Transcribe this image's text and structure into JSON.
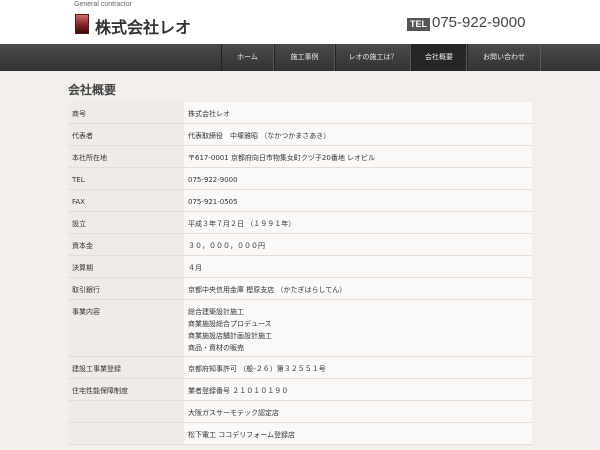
{
  "header": {
    "tagline": "General contractor",
    "company": "株式会社レオ",
    "tel_badge": "TEL",
    "tel_number": "075-922-9000"
  },
  "nav": {
    "items": [
      {
        "label": "ホーム"
      },
      {
        "label": "施工事例"
      },
      {
        "label": "レオの施工は？"
      },
      {
        "label": "会社概要",
        "active": true
      },
      {
        "label": "お問い合わせ"
      }
    ]
  },
  "section": {
    "title": "会社概要"
  },
  "table": {
    "rows": [
      {
        "label": "商号",
        "values": [
          "株式会社レオ"
        ]
      },
      {
        "label": "代表者",
        "values": [
          "代表取締役　中塚雅昭 （なかつかまさあき）"
        ]
      },
      {
        "label": "本社所在地",
        "values": [
          "〒617-0001 京都府向日市物集女町クヅ子20番地 レオビル"
        ]
      },
      {
        "label": "TEL",
        "values": [
          "075-922-9000"
        ]
      },
      {
        "label": "FAX",
        "values": [
          "075-921-0505"
        ]
      },
      {
        "label": "設立",
        "values": [
          "平成３年７月２日 （１９９１年）"
        ]
      },
      {
        "label": "資本金",
        "values": [
          "３０，０００，０００円"
        ]
      },
      {
        "label": "決算期",
        "values": [
          "４月"
        ]
      },
      {
        "label": "取引銀行",
        "values": [
          "京都中央信用金庫 樫原支店 （かたぎはらしてん）"
        ]
      },
      {
        "label": "事業内容",
        "values": [
          "総合建築設計施工",
          "商業施設総合プロデュース",
          "商業施設店舗計画設計施工",
          "商品・資材の販売"
        ]
      },
      {
        "label": "建設工事業登録",
        "values": [
          "京都府知事許可 （般-２６）第３２５５１号"
        ]
      },
      {
        "label": "住宅性能保障制度",
        "values": [
          "業者登録番号 ２１０１０１９０"
        ]
      },
      {
        "label": "",
        "values": [
          "大阪ガスサーモテック認定店"
        ]
      },
      {
        "label": "",
        "values": [
          "松下電工 ココデリフォーム登録店"
        ]
      }
    ]
  }
}
